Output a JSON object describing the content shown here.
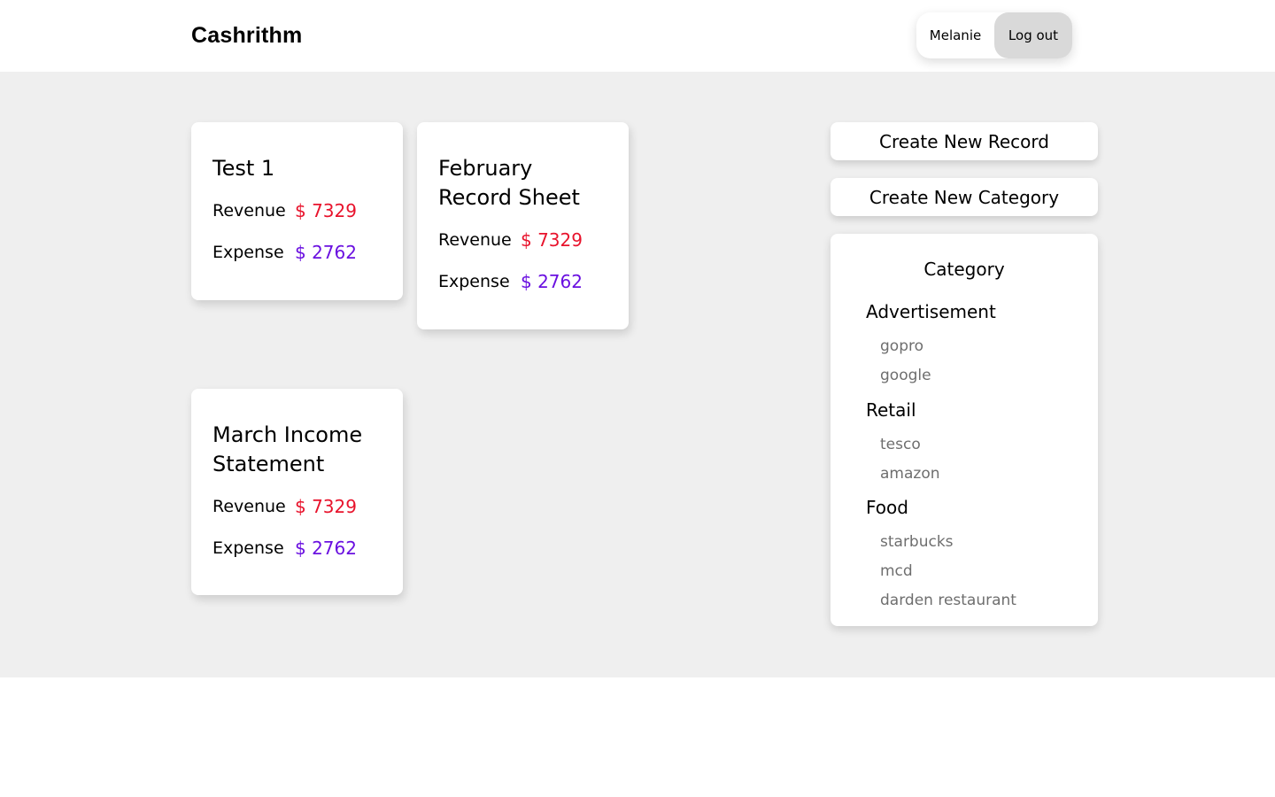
{
  "header": {
    "logo": "Cashrithm",
    "user_name": "Melanie",
    "logout_label": "Log out"
  },
  "labels": {
    "revenue": "Revenue",
    "expense": "Expense"
  },
  "records": [
    {
      "title": "Test 1",
      "revenue": "$ 7329",
      "expense": "$ 2762"
    },
    {
      "title": "February Record Sheet",
      "revenue": "$ 7329",
      "expense": "$ 2762"
    },
    {
      "title": "March Income Statement",
      "revenue": "$ 7329",
      "expense": "$ 2762"
    }
  ],
  "actions": {
    "create_record": "Create New Record",
    "create_category": "Create New Category"
  },
  "categories": {
    "heading": "Category",
    "groups": [
      {
        "name": "Advertisement",
        "items": [
          "gopro",
          "google"
        ]
      },
      {
        "name": "Retail",
        "items": [
          "tesco",
          "amazon"
        ]
      },
      {
        "name": "Food",
        "items": [
          "starbucks",
          "mcd",
          "darden restaurant"
        ]
      }
    ]
  },
  "colors": {
    "revenue": "#e8132c",
    "expense": "#6a10e0",
    "background": "#efefef"
  }
}
